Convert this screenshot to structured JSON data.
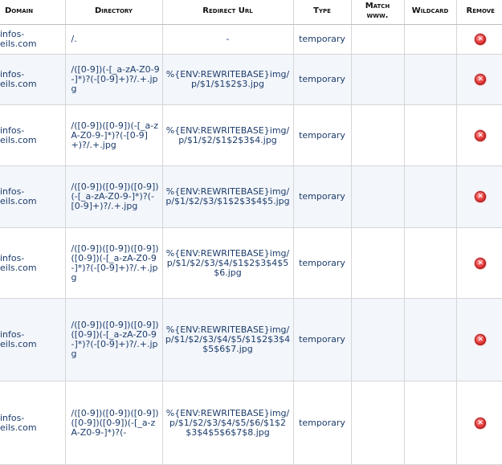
{
  "columns": {
    "domain": "Domain",
    "directory": "Directory",
    "redirect_url": "Redirect Url",
    "type": "Type",
    "match_www": "Match www.",
    "wildcard": "Wildcard",
    "remove": "Remove"
  },
  "rows": [
    {
      "domain": [
        "infos-",
        "eils.com"
      ],
      "directory": "/.",
      "redirect_url": "-",
      "type": "temporary",
      "match_www": "",
      "wildcard": "",
      "remove_icon": "remove-x-icon"
    },
    {
      "domain": [
        "infos-",
        "eils.com"
      ],
      "directory": "/([0-9])(-[_a-zA-Z0-9-]*)?(-[0-9]+)?/.+.jpg",
      "redirect_url": "%{ENV:REWRITEBASE}img/p/$1/$1$2$3.jpg",
      "type": "temporary",
      "match_www": "",
      "wildcard": "",
      "remove_icon": "remove-x-icon"
    },
    {
      "domain": [
        "infos-",
        "eils.com"
      ],
      "directory": "/([0-9])([0-9])(-[_a-zA-Z0-9-]*)?(-[0-9]+)?/.+.jpg",
      "redirect_url": "%{ENV:REWRITEBASE}img/p/$1/$2/$1$2$3$4.jpg",
      "type": "temporary",
      "match_www": "",
      "wildcard": "",
      "remove_icon": "remove-x-icon"
    },
    {
      "domain": [
        "infos-",
        "eils.com"
      ],
      "directory": "/([0-9])([0-9])([0-9])(-[_a-zA-Z0-9-]*)?(-[0-9]+)?/.+.jpg",
      "redirect_url": "%{ENV:REWRITEBASE}img/p/$1/$2/$3/$1$2$3$4$5.jpg",
      "type": "temporary",
      "match_www": "",
      "wildcard": "",
      "remove_icon": "remove-x-icon"
    },
    {
      "domain": [
        "infos-",
        "eils.com"
      ],
      "directory": "/([0-9])([0-9])([0-9])([0-9])(-[_a-zA-Z0-9-]*)?(-[0-9]+)?/.+.jpg",
      "redirect_url": "%{ENV:REWRITEBASE}img/p/$1/$2/$3/$4/$1$2$3$4$5$6.jpg",
      "type": "temporary",
      "match_www": "",
      "wildcard": "",
      "remove_icon": "remove-x-icon"
    },
    {
      "domain": [
        "infos-",
        "eils.com"
      ],
      "directory": "/([0-9])([0-9])([0-9])([0-9])(-[_a-zA-Z0-9-]*)?(-[0-9]+)?/.+.jpg",
      "redirect_url": "%{ENV:REWRITEBASE}img/p/$1/$2/$3/$4/$5/$1$2$3$4$5$6$7.jpg",
      "type": "temporary",
      "match_www": "",
      "wildcard": "",
      "remove_icon": "remove-x-icon"
    },
    {
      "domain": [
        "infos-",
        "eils.com"
      ],
      "directory": "/([0-9])([0-9])([0-9])([0-9])([0-9])(-[_a-zA-Z0-9-]*)?(-",
      "redirect_url": "%{ENV:REWRITEBASE}img/p/$1/$2/$3/$4/$5/$6/$1$2$3$4$5$6$7$8.jpg",
      "type": "temporary",
      "match_www": "",
      "wildcard": "",
      "remove_icon": "remove-x-icon"
    }
  ]
}
